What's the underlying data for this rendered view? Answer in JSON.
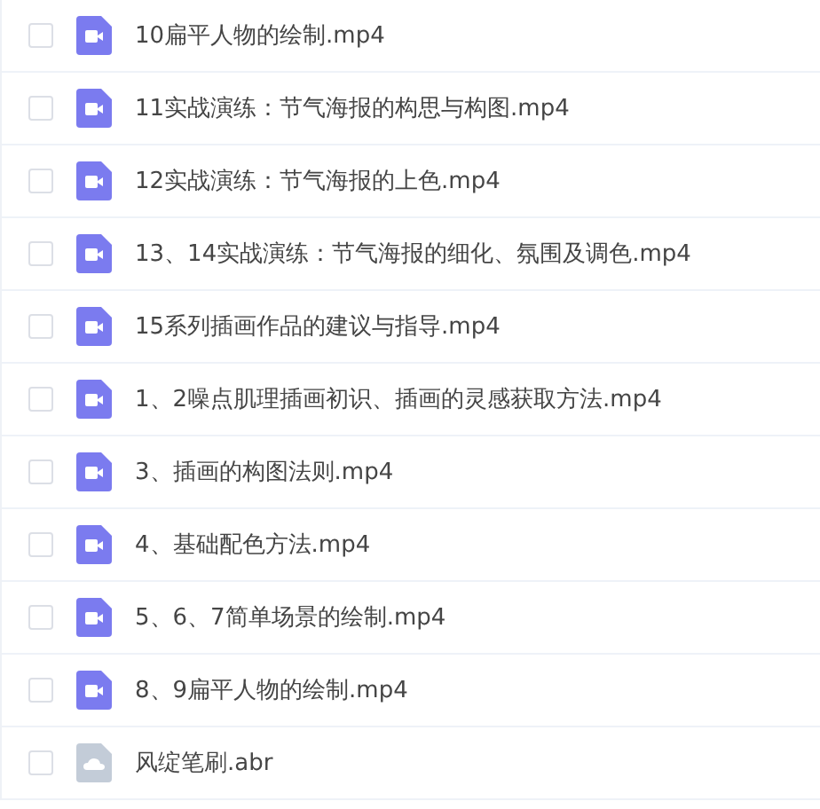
{
  "files": [
    {
      "name": "10扁平人物的绘制.mp4",
      "kind": "video",
      "checked": false
    },
    {
      "name": "11实战演练：节气海报的构思与构图.mp4",
      "kind": "video",
      "checked": false
    },
    {
      "name": "12实战演练：节气海报的上色.mp4",
      "kind": "video",
      "checked": false
    },
    {
      "name": "13、14实战演练：节气海报的细化、氛围及调色.mp4",
      "kind": "video",
      "checked": false
    },
    {
      "name": "15系列插画作品的建议与指导.mp4",
      "kind": "video",
      "checked": false
    },
    {
      "name": "1、2噪点肌理插画初识、插画的灵感获取方法.mp4",
      "kind": "video",
      "checked": false
    },
    {
      "name": "3、插画的构图法则.mp4",
      "kind": "video",
      "checked": false
    },
    {
      "name": "4、基础配色方法.mp4",
      "kind": "video",
      "checked": false
    },
    {
      "name": "5、6、7简单场景的绘制.mp4",
      "kind": "video",
      "checked": false
    },
    {
      "name": "8、9扁平人物的绘制.mp4",
      "kind": "video",
      "checked": false
    },
    {
      "name": "风绽笔刷.abr",
      "kind": "file",
      "checked": false
    }
  ]
}
